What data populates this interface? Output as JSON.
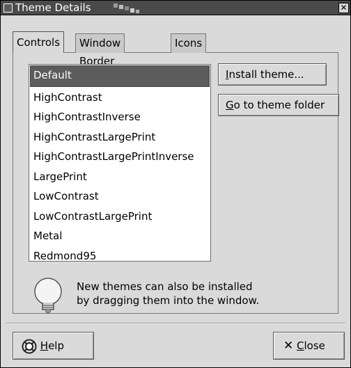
{
  "window": {
    "title": "Theme Details"
  },
  "tabs": [
    {
      "label": "Controls"
    },
    {
      "label": "Window Border"
    },
    {
      "label": "Icons"
    }
  ],
  "themes": [
    "Default",
    "HighContrast",
    "HighContrastInverse",
    "HighContrastLargePrint",
    "HighContrastLargePrintInverse",
    "LargePrint",
    "LowContrast",
    "LowContrastLargePrint",
    "Metal",
    "Redmond95"
  ],
  "selected_theme": "Default",
  "buttons": {
    "install_first": "I",
    "install_rest": "nstall theme...",
    "goto_first": "G",
    "goto_rest": "o to theme folder",
    "help_first": "H",
    "help_rest": "elp",
    "close_first": "C",
    "close_rest": "lose"
  },
  "info": {
    "line1": "New themes can also be installed",
    "line2": "by dragging them into the window."
  },
  "icons": {
    "window_icon": "window-icon",
    "close": "close-icon",
    "help": "help-icon",
    "close_button": "x-icon",
    "tip": "lightbulb-icon"
  }
}
